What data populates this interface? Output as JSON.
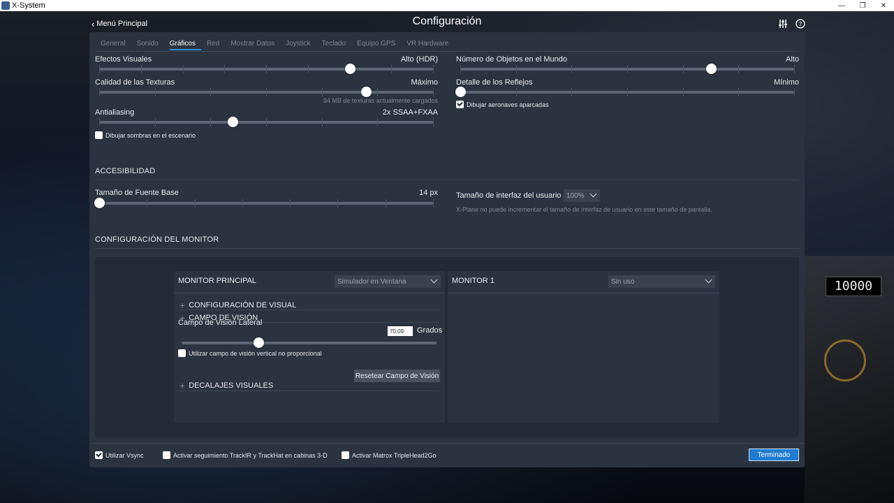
{
  "window": {
    "title": "X-System"
  },
  "colors": {
    "accent": "#1f7bd1",
    "panel": "#2b3341",
    "thumb": "#ffffff"
  },
  "header": {
    "back_label": "Menú Principal",
    "title": "Configuración",
    "icons": [
      "sliders-icon",
      "help-icon"
    ]
  },
  "tabs": [
    {
      "label": "General",
      "active": false
    },
    {
      "label": "Sonido",
      "active": false
    },
    {
      "label": "Gráficos",
      "active": true
    },
    {
      "label": "Red",
      "active": false
    },
    {
      "label": "Mostrar Datos",
      "active": false
    },
    {
      "label": "Joystick",
      "active": false
    },
    {
      "label": "Teclado",
      "active": false
    },
    {
      "label": "Equipo GPS",
      "active": false
    },
    {
      "label": "VR Hardware",
      "active": false
    }
  ],
  "graphics": {
    "visual_effects": {
      "label": "Efectos Visuales",
      "value": "Alto (HDR)",
      "level": 0.75
    },
    "texture_quality": {
      "label": "Calidad de las Texturas",
      "value": "Máximo",
      "level": 0.8,
      "note": "94 MB de texturas actualmente cargados"
    },
    "antialiasing": {
      "label": "Antialiasing",
      "value": "2x SSAA+FXAA",
      "level": 0.4
    },
    "draw_shadows": {
      "label": "Dibujar sombras en el escenario",
      "checked": false
    },
    "world_objects": {
      "label": "Número de Objetos en el Mundo",
      "value": "Alto",
      "level": 0.75
    },
    "reflection_detail": {
      "label": "Detalle de los Reflejos",
      "value": "Mínimo",
      "level": 0.0
    },
    "draw_parked_aircraft": {
      "label": "Dibujar aeronaves aparcadas",
      "checked": true
    }
  },
  "accessibility": {
    "title": "ACCESIBILIDAD",
    "font_size": {
      "label": "Tamaño de Fuente Base",
      "value": "14 px",
      "level": 0.0
    },
    "ui_size": {
      "label": "Tamaño de interfaz del usuario",
      "value": "100%",
      "note": "X-Plane no puede incrementar el tamaño de interfaz de usuario en este tamaño de pantalla."
    }
  },
  "monitor_config": {
    "title": "CONFIGURACIÓN DEL MONITOR",
    "main": {
      "title": "MONITOR PRINCIPAL",
      "mode": "Simulador en Ventana",
      "visual_config": "CONFIGURACIÓN DE VISUAL",
      "fov_section": "CAMPO DE VISIÓN",
      "lateral_fov_label": "Campo de Visión Lateral",
      "lateral_fov_value": "70.09",
      "lateral_fov_unit": "Grados",
      "lateral_fov_level": 0.3,
      "vertical_fov_checkbox": {
        "label": "Utilizar campo de visión vertical no proporcional",
        "checked": false
      },
      "reset_button": "Resetear Campo de Visión",
      "visual_offsets": "DECALAJES VISUALES"
    },
    "monitor1": {
      "title": "MONITOR 1",
      "mode": "Sin uso"
    }
  },
  "footer": {
    "vsync": {
      "label": "Utilizar Vsync",
      "checked": true
    },
    "trackir": {
      "label": "Activar seguimiento TrackIR y TrackHat en cabinas 3-D",
      "checked": false
    },
    "matrox": {
      "label": "Activar Matrox TripleHead2Go",
      "checked": false
    },
    "done_button": "Terminado"
  }
}
